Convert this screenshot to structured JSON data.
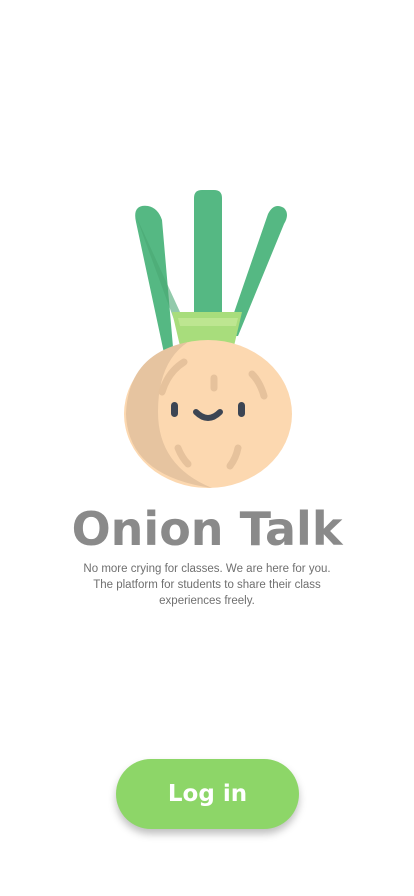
{
  "app": {
    "title": "Onion Talk",
    "mascot_icon": "onion-mascot-icon"
  },
  "tagline": {
    "line1": "No more crying for classes. We are here for you.",
    "line2": "The platform for students to share their class",
    "line3": "experiences freely."
  },
  "actions": {
    "login_label": "Log in"
  },
  "colors": {
    "title": "#8a8a8a",
    "button": "#8dd668",
    "leaves": "#55b883",
    "bulb": "#fcd8b0"
  }
}
